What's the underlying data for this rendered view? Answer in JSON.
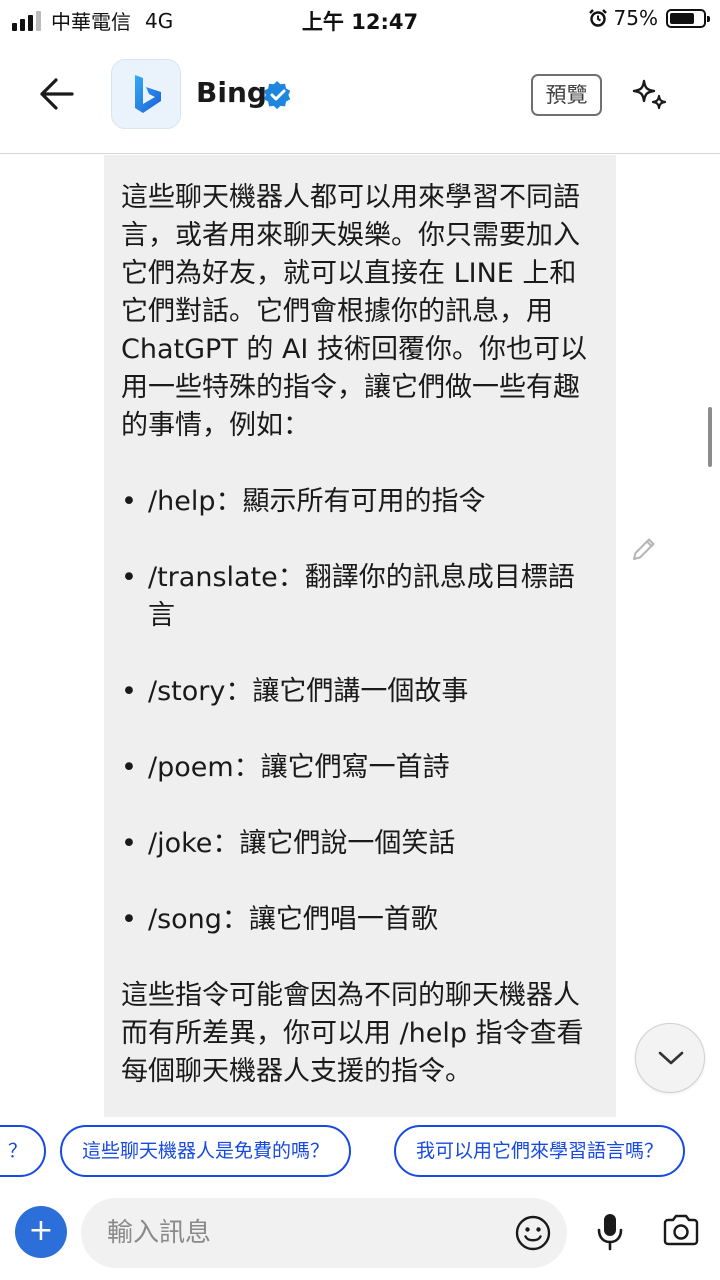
{
  "status_bar": {
    "carrier": "中華電信",
    "network": "4G",
    "time": "上午 12:47",
    "battery_percent": "75%",
    "battery_level": 0.75
  },
  "header": {
    "back_icon": "arrow-left-icon",
    "bot_name": "Bing",
    "verified_icon": "verified-badge-icon",
    "preview_label": "預覽",
    "sparkle_icon": "sparkle-icon"
  },
  "message": {
    "intro": "這些聊天機器人都可以用來學習不同語言，或者用來聊天娛樂。你只需要加入它們為好友，就可以直接在 LINE 上和它們對話。它們會根據你的訊息，用 ChatGPT 的 AI 技術回覆你。你也可以用一些特殊的指令，讓它們做一些有趣的事情，例如：",
    "bullets": [
      "/help：顯示所有可用的指令",
      "/translate：翻譯你的訊息成目標語言",
      "/story：讓它們講一個故事",
      "/poem：讓它們寫一首詩",
      "/joke：讓它們說一個笑話",
      "/song：讓它們唱一首歌"
    ],
    "outro": "這些指令可能會因為不同的聊天機器人而有所差異，你可以用 /help 指令查看每個聊天機器人支援的指令。"
  },
  "suggestions": [
    "？",
    "這些聊天機器人是免費的嗎？",
    "我可以用它們來學習語言嗎？"
  ],
  "input": {
    "placeholder": "輸入訊息",
    "add_icon": "plus-icon",
    "emoji_icon": "emoji-icon",
    "mic_icon": "microphone-icon",
    "camera_icon": "camera-icon"
  },
  "colors": {
    "accent": "#174ae4",
    "bubble": "#efefef",
    "add_button": "#2d6fd9"
  }
}
